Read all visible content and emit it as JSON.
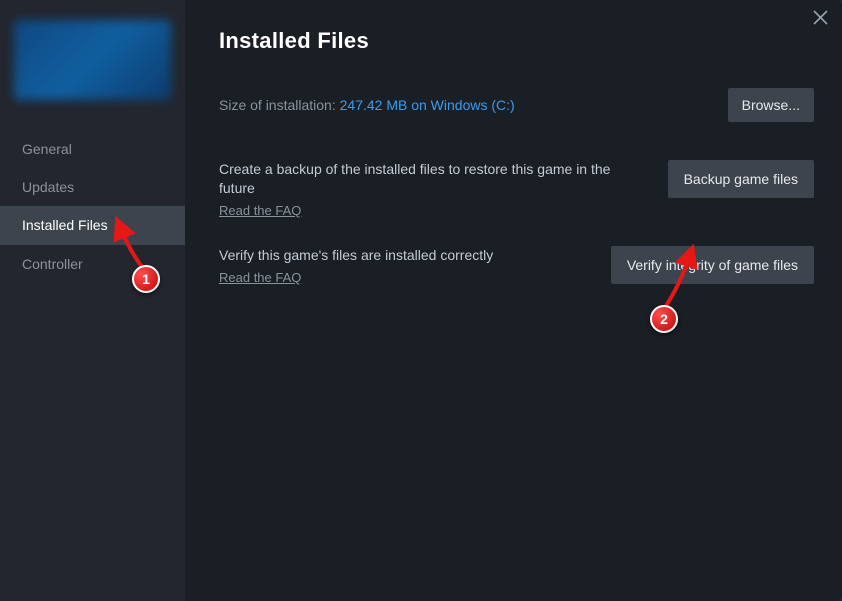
{
  "sidebar": {
    "items": [
      {
        "label": "General"
      },
      {
        "label": "Updates"
      },
      {
        "label": "Installed Files"
      },
      {
        "label": "Controller"
      }
    ],
    "active_index": 2
  },
  "header": {
    "title": "Installed Files"
  },
  "size_row": {
    "prefix": "Size of installation: ",
    "value": "247.42 MB on Windows (C:)",
    "browse_label": "Browse..."
  },
  "backup_row": {
    "text": "Create a backup of the installed files to restore this game in the future",
    "faq": "Read the FAQ",
    "button": "Backup game files"
  },
  "verify_row": {
    "text": "Verify this game's files are installed correctly",
    "faq": "Read the FAQ",
    "button": "Verify integrity of game files"
  },
  "annotations": {
    "step1": "1",
    "step2": "2"
  }
}
